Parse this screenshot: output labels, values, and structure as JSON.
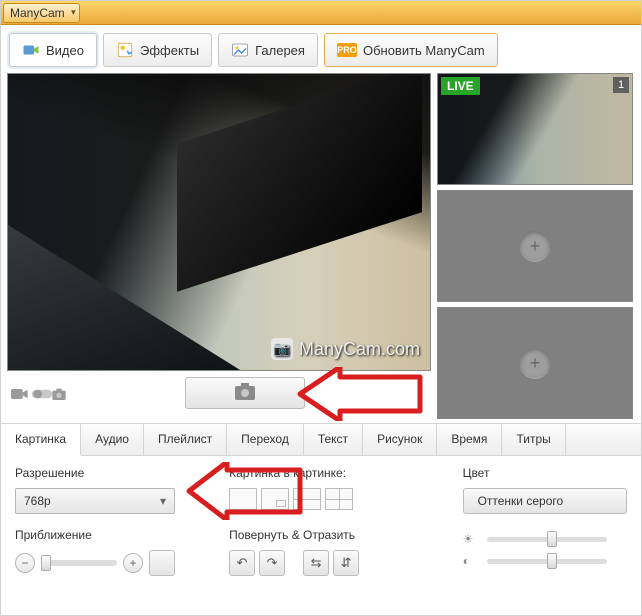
{
  "app": {
    "title": "ManyCam"
  },
  "nav": {
    "video": "Видео",
    "effects": "Эффекты",
    "gallery": "Галерея",
    "update": "Обновить ManyCam",
    "pro": "PRO"
  },
  "preview": {
    "watermark": "ManyCam.com",
    "live_badge": "LIVE",
    "source1_index": "1"
  },
  "prop_tabs": {
    "picture": "Картинка",
    "audio": "Аудио",
    "playlist": "Плейлист",
    "transition": "Переход",
    "text": "Текст",
    "drawing": "Рисунок",
    "time": "Время",
    "titles": "Титры"
  },
  "settings": {
    "resolution_label": "Разрешение",
    "resolution_value": "768p",
    "zoom_label": "Приближение",
    "pip_label": "Картинка в картинке:",
    "rotate_label": "Повернуть & Отразить",
    "color_label": "Цвет",
    "grayscale_btn": "Оттенки серого"
  }
}
